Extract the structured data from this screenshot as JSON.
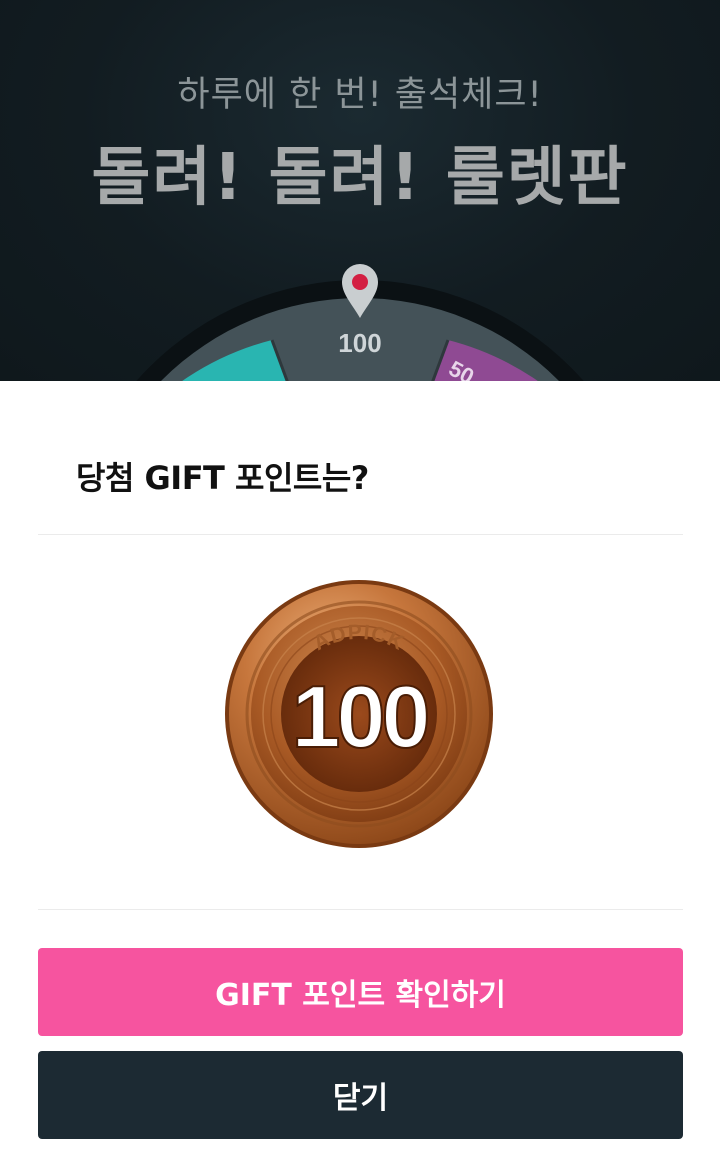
{
  "background": {
    "subtitle": "하루에 한 번! 출석체크!",
    "title": "돌려! 돌려! 룰렛판",
    "wheel": {
      "top_value": "100",
      "right_value": "50",
      "pointer_icon": "map-pin-icon"
    }
  },
  "modal": {
    "title": "당첨 GIFT 포인트는?",
    "coin": {
      "brand": "ADPICK",
      "value": "100",
      "icon": "bronze-coin-icon"
    },
    "buttons": {
      "confirm_label": "GIFT 포인트 확인하기",
      "close_label": "닫기"
    }
  },
  "colors": {
    "confirm_button": "#f6549f",
    "close_button": "#1c2a33",
    "background_dark": "#121c21"
  }
}
